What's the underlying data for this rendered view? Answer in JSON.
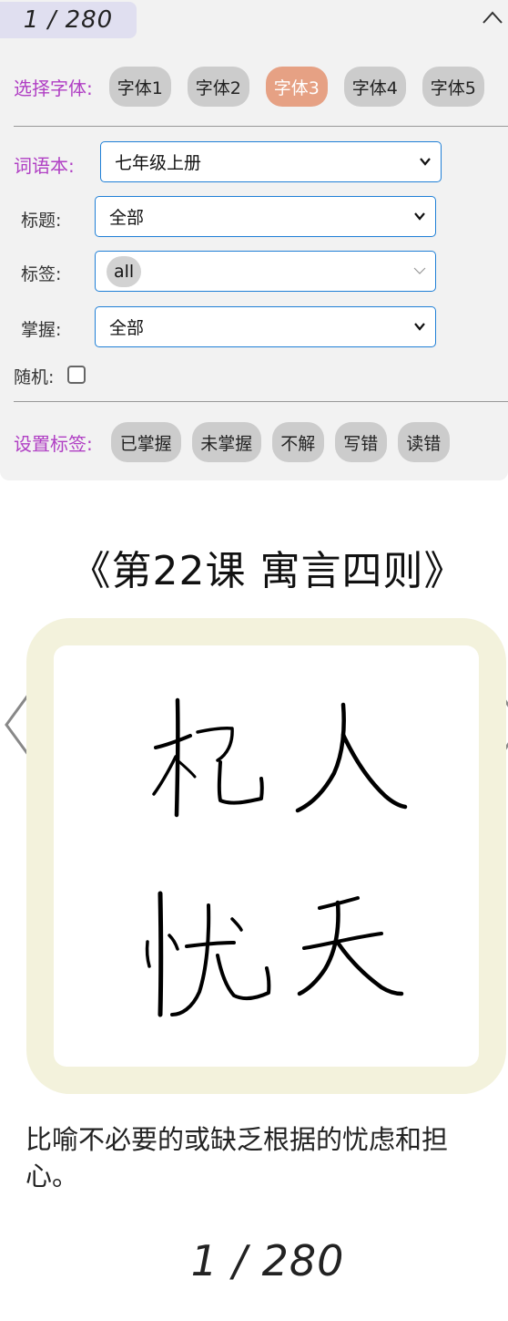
{
  "header": {
    "counter": "1 / 280",
    "collapse_icon": "chevron-up-icon"
  },
  "fonts": {
    "label": "选择字体:",
    "options": [
      "字体1",
      "字体2",
      "字体3",
      "字体4",
      "字体5"
    ],
    "active_index": 2,
    "active_color": "#e6a184"
  },
  "filters": {
    "wordbook_label": "词语本:",
    "wordbook_value": "七年级上册",
    "title_label": "标题:",
    "title_value": "全部",
    "tag_label": "标签:",
    "tag_value": "all",
    "mastery_label": "掌握:",
    "mastery_value": "全部",
    "random_label": "随机:",
    "random_checked": false
  },
  "set_tag": {
    "label": "设置标签:",
    "options": [
      "已掌握",
      "未掌握",
      "不解",
      "写错",
      "读错"
    ]
  },
  "lesson_title": "《第22课 寓言四则》",
  "card": {
    "characters": [
      "杞",
      "人",
      "忧",
      "天"
    ]
  },
  "definition": "比喻不必要的或缺乏根据的忧虑和担心。",
  "footer": {
    "counter": "1 / 280"
  },
  "colors": {
    "accent_label": "#b03fc4",
    "select_border": "#1f7fd6",
    "card_frame": "#f3f2dc",
    "counter_pill": "#e0dff0"
  }
}
